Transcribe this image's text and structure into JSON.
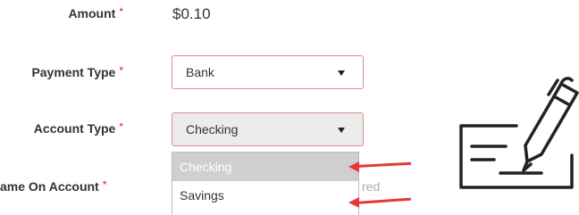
{
  "form": {
    "amount": {
      "label": "Amount",
      "value": "$0.10"
    },
    "payment_type": {
      "label": "Payment Type",
      "value": "Bank"
    },
    "account_type": {
      "label": "Account Type",
      "value": "Checking",
      "options": [
        "Checking",
        "Savings"
      ]
    },
    "name_on_account": {
      "label": "ame On Account",
      "hint_fragment": "red"
    },
    "required_marker": "*"
  },
  "annotation": {
    "color": "#e53935"
  },
  "icons": {
    "check_signing": "check-and-pen-icon"
  }
}
